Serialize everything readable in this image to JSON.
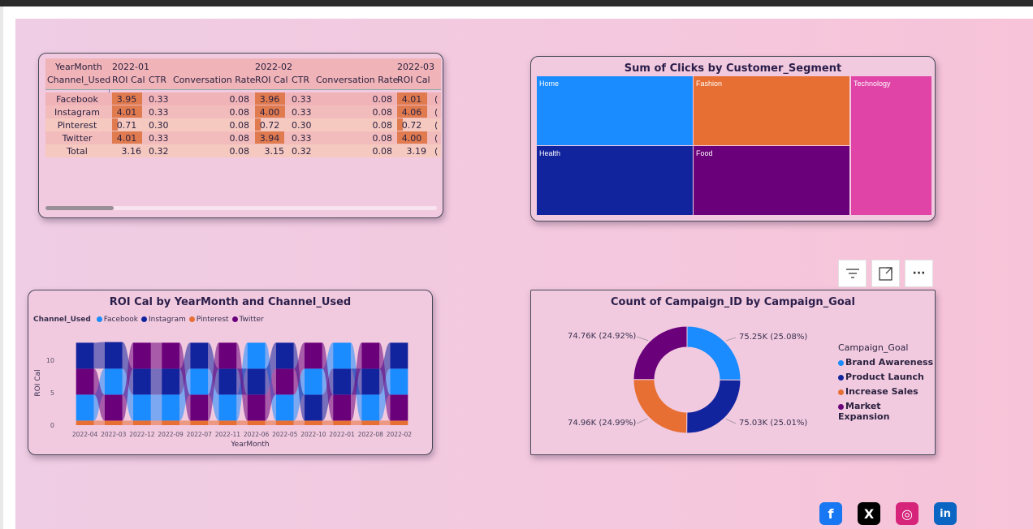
{
  "matrix": {
    "row_header_top": "YearMonth",
    "row_header": "Channel_Used",
    "periods": [
      "2022-01",
      "2022-02",
      "2022-03"
    ],
    "columns": [
      "ROI Cal",
      "CTR",
      "Conversation Rate"
    ],
    "rows": [
      {
        "channel": "Facebook",
        "p1": [
          "3.95",
          "0.33",
          "0.08"
        ],
        "p2": [
          "3.96",
          "0.33",
          "0.08"
        ],
        "p3": [
          "4.01"
        ],
        "bars": [
          0.99,
          0.99,
          1.0
        ]
      },
      {
        "channel": "Instagram",
        "p1": [
          "4.01",
          "0.33",
          "0.08"
        ],
        "p2": [
          "4.00",
          "0.33",
          "0.08"
        ],
        "p3": [
          "4.06"
        ],
        "bars": [
          1.0,
          1.0,
          1.0
        ]
      },
      {
        "channel": "Pinterest",
        "p1": [
          "0.71",
          "0.30",
          "0.08"
        ],
        "p2": [
          "0.72",
          "0.30",
          "0.08"
        ],
        "p3": [
          "0.72"
        ],
        "bars": [
          0.18,
          0.18,
          0.18
        ]
      },
      {
        "channel": "Twitter",
        "p1": [
          "4.01",
          "0.33",
          "0.08"
        ],
        "p2": [
          "3.94",
          "0.33",
          "0.08"
        ],
        "p3": [
          "4.00"
        ],
        "bars": [
          1.0,
          0.98,
          1.0
        ]
      }
    ],
    "total": {
      "channel": "Total",
      "p1": [
        "3.16",
        "0.32",
        "0.08"
      ],
      "p2": [
        "3.15",
        "0.32",
        "0.08"
      ],
      "p3": [
        "3.19"
      ]
    }
  },
  "treemap": {
    "title": "Sum of Clicks by Customer_Segment",
    "tiles": [
      {
        "label": "Home",
        "color": "#1a8cff"
      },
      {
        "label": "Fashion",
        "color": "#e86f34"
      },
      {
        "label": "Technology",
        "color": "#e044a7"
      },
      {
        "label": "Health",
        "color": "#12239e"
      },
      {
        "label": "Food",
        "color": "#6b007b"
      }
    ]
  },
  "ribbon": {
    "title": "ROI Cal by YearMonth and Channel_Used",
    "legend_title": "Channel_Used",
    "legend": [
      {
        "name": "Facebook",
        "color": "#1a8cff"
      },
      {
        "name": "Instagram",
        "color": "#12239e"
      },
      {
        "name": "Pinterest",
        "color": "#e86f34"
      },
      {
        "name": "Twitter",
        "color": "#6b007b"
      }
    ],
    "ylabel": "ROI Cal",
    "xlabel": "YearMonth",
    "yticks": [
      "10",
      "5",
      "0"
    ]
  },
  "chart_data": [
    {
      "type": "bar",
      "title": "ROI Cal by YearMonth and Channel_Used",
      "stacked": true,
      "xlabel": "YearMonth",
      "ylabel": "ROI Cal",
      "ylim": [
        0,
        13
      ],
      "legend": "top-left",
      "categories": [
        "2022-04",
        "2022-03",
        "2022-12",
        "2022-09",
        "2022-07",
        "2022-11",
        "2022-06",
        "2022-05",
        "2022-10",
        "2022-01",
        "2022-08",
        "2022-02"
      ],
      "series": [
        {
          "name": "Pinterest",
          "values": [
            0.7,
            0.7,
            0.7,
            0.7,
            0.7,
            0.7,
            0.7,
            0.7,
            0.7,
            0.7,
            0.7,
            0.7
          ]
        },
        {
          "name": "Facebook",
          "values": [
            4.0,
            4.0,
            4.0,
            4.0,
            4.0,
            4.0,
            4.0,
            4.0,
            4.0,
            4.0,
            4.0,
            4.0
          ]
        },
        {
          "name": "Instagram",
          "values": [
            4.0,
            4.1,
            4.0,
            4.0,
            4.0,
            4.0,
            4.0,
            4.0,
            4.0,
            4.0,
            4.0,
            4.0
          ]
        },
        {
          "name": "Twitter",
          "values": [
            4.0,
            4.0,
            4.0,
            4.0,
            4.0,
            4.0,
            4.0,
            4.0,
            4.0,
            4.0,
            4.0,
            4.0
          ]
        }
      ]
    },
    {
      "type": "pie",
      "title": "Count of Campaign_ID by Campaign_Goal",
      "legend": "right",
      "categories": [
        "Brand Awareness",
        "Product Launch",
        "Increase Sales",
        "Market Expansion"
      ],
      "values": [
        75250,
        75030,
        74960,
        74760
      ],
      "labels": [
        "75.25K (25.08%)",
        "75.03K (25.01%)",
        "74.96K (24.99%)",
        "74.76K (24.92%)"
      ],
      "colors": [
        "#1a8cff",
        "#12239e",
        "#e86f34",
        "#6b007b"
      ]
    }
  ],
  "donut": {
    "title": "Count of Campaign_ID by Campaign_Goal",
    "legend_title": "Campaign_Goal"
  },
  "toolbar": {
    "icons": [
      "filter-icon",
      "focus-mode-icon",
      "more-options-icon"
    ],
    "more": "···"
  },
  "social": [
    {
      "name": "facebook",
      "glyph": "f",
      "color": "#1877f2"
    },
    {
      "name": "x",
      "glyph": "X",
      "color": "#000000"
    },
    {
      "name": "instagram",
      "glyph": "◎",
      "color": "#d6247a"
    },
    {
      "name": "linkedin",
      "glyph": "in",
      "color": "#0a66c2"
    }
  ]
}
